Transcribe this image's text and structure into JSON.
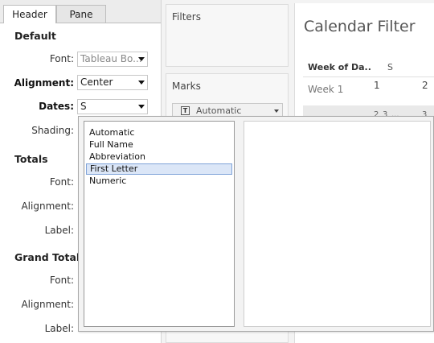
{
  "tabs": [
    {
      "label": "Header"
    },
    {
      "label": "Pane"
    }
  ],
  "default": {
    "title": "Default",
    "font_label": "Font:",
    "font_value": "Tableau Bo...",
    "alignment_label": "Alignment:",
    "alignment_value": "Center",
    "dates_label": "Dates:",
    "dates_value": "S",
    "shading_label": "Shading:"
  },
  "totals": {
    "title": "Totals",
    "font_label": "Font:",
    "alignment_label": "Alignment:",
    "label_label": "Label:"
  },
  "grand_totals": {
    "title": "Grand Totals",
    "font_label": "Font:",
    "alignment_label": "Alignment:",
    "label_label": "Label:"
  },
  "filters": {
    "title": "Filters"
  },
  "marks": {
    "title": "Marks",
    "type": "Automatic"
  },
  "view": {
    "title": "Calendar Filter",
    "col_header": "Week of Da..",
    "day_header": "S",
    "row_label": "Week 1",
    "cells": [
      "1",
      "2"
    ],
    "partial_row": [
      "2",
      "3",
      "...",
      "3"
    ]
  },
  "dropdown": {
    "options": [
      {
        "label": "Automatic"
      },
      {
        "label": "Full Name"
      },
      {
        "label": "Abbreviation"
      },
      {
        "label": "First Letter"
      },
      {
        "label": "Numeric"
      }
    ],
    "selected": "First Letter"
  }
}
